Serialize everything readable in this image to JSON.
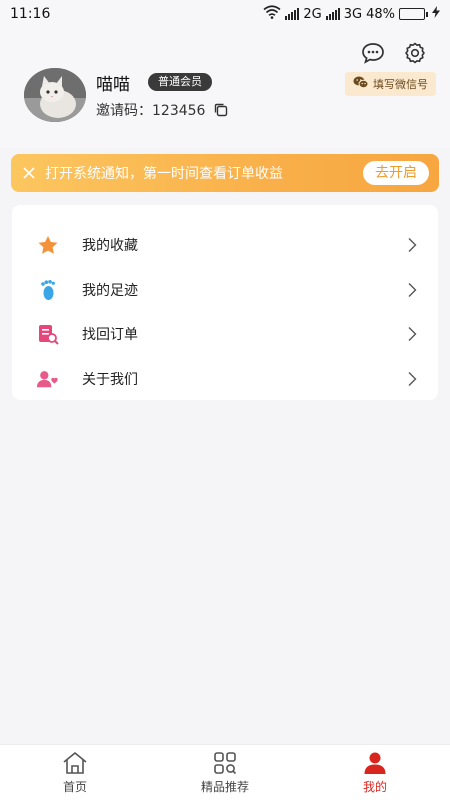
{
  "status_bar": {
    "time": "11:16",
    "net1": "2G",
    "net2": "3G",
    "battery": "48%",
    "battery_level": 0.48
  },
  "profile": {
    "name": "喵喵",
    "member_badge": "普通会员",
    "invite_label": "邀请码：123456",
    "wechat_button": "填写微信号"
  },
  "notice": {
    "text": "打开系统通知，第一时间查看订单收益",
    "action": "去开启"
  },
  "menu": {
    "items": [
      {
        "label": "我的收藏",
        "icon": "star-icon"
      },
      {
        "label": "我的足迹",
        "icon": "footprint-icon"
      },
      {
        "label": "找回订单",
        "icon": "order-search-icon"
      },
      {
        "label": "关于我们",
        "icon": "users-heart-icon"
      }
    ]
  },
  "tabbar": {
    "tabs": [
      {
        "label": "首页",
        "icon": "home-icon"
      },
      {
        "label": "精品推荐",
        "icon": "grid-search-icon"
      },
      {
        "label": "我的",
        "icon": "person-icon",
        "active": true
      }
    ]
  },
  "colors": {
    "accent": "#d8261f",
    "notice_start": "#fcc65f",
    "notice_end": "#f7a640",
    "wechat_bg": "#fbe9cf"
  }
}
